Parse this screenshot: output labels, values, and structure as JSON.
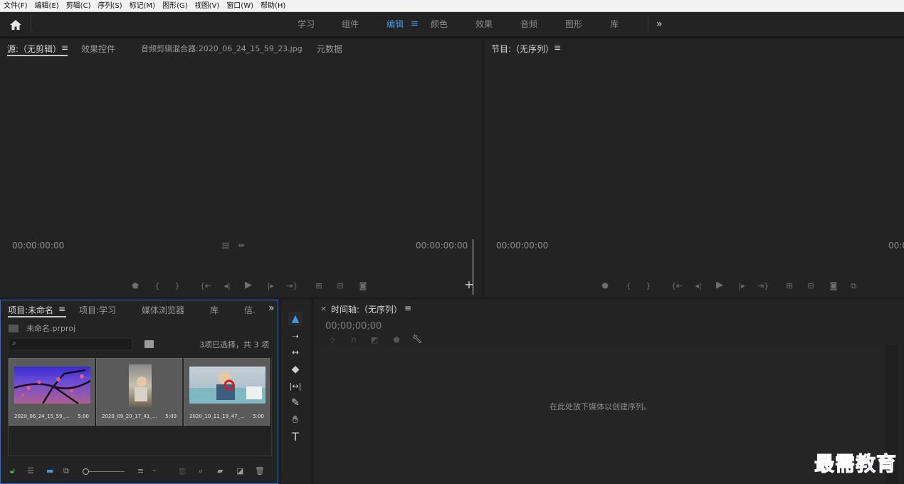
{
  "menu": [
    "文件(F)",
    "编辑(E)",
    "剪辑(C)",
    "序列(S)",
    "标记(M)",
    "图形(G)",
    "视图(V)",
    "窗口(W)",
    "帮助(H)"
  ],
  "workspaces": {
    "tabs": [
      "学习",
      "组件",
      "编辑",
      "颜色",
      "效果",
      "音频",
      "图形",
      "库"
    ],
    "active": "编辑",
    "more": "»"
  },
  "source_panel": {
    "tabs": [
      "源:（无剪辑）",
      "效果控件",
      "音频剪辑混合器:2020_06_24_15_59_23.jpg",
      "元数据"
    ],
    "menu_icon": "≡",
    "timecode_left": "00:00:00:00",
    "timecode_right": "00:00:00:00"
  },
  "program_panel": {
    "title": "节目:（无序列）",
    "menu_icon": "≡",
    "timecode_left": "00:00:00:00",
    "timecode_right": "00:0"
  },
  "project_panel": {
    "tabs": [
      "项目:未命名",
      "项目:学习",
      "媒体浏览器",
      "库",
      "信."
    ],
    "menu_icon": "≡",
    "more": "»",
    "project_file": "未命名.prproj",
    "search_placeholder": "",
    "selection_status": "3项已选择，共 3 项",
    "items": [
      {
        "name": "2020_06_24_15_59_...",
        "duration": "5:00"
      },
      {
        "name": "2020_09_20_17_41_...",
        "duration": "5:00"
      },
      {
        "name": "2020_10_11_19_47_...",
        "duration": "5:00"
      }
    ]
  },
  "tools": [
    "selection-tool",
    "track-select-tool",
    "ripple-edit-tool",
    "razor-tool",
    "slip-tool",
    "pen-tool",
    "hand-tool",
    "type-tool"
  ],
  "timeline_panel": {
    "close": "×",
    "title": "时间轴:（无序列）",
    "menu_icon": "≡",
    "timecode": "00;00;00;00",
    "drop_hint": "在此处放下媒体以创建序列。"
  },
  "watermark": "最需教育",
  "colors": {
    "accent": "#3d9ae8",
    "panel_bg": "#232323",
    "app_bg": "#1d1d1d",
    "watermark": "#1a3fb8",
    "lock_green": "#3cb043"
  }
}
